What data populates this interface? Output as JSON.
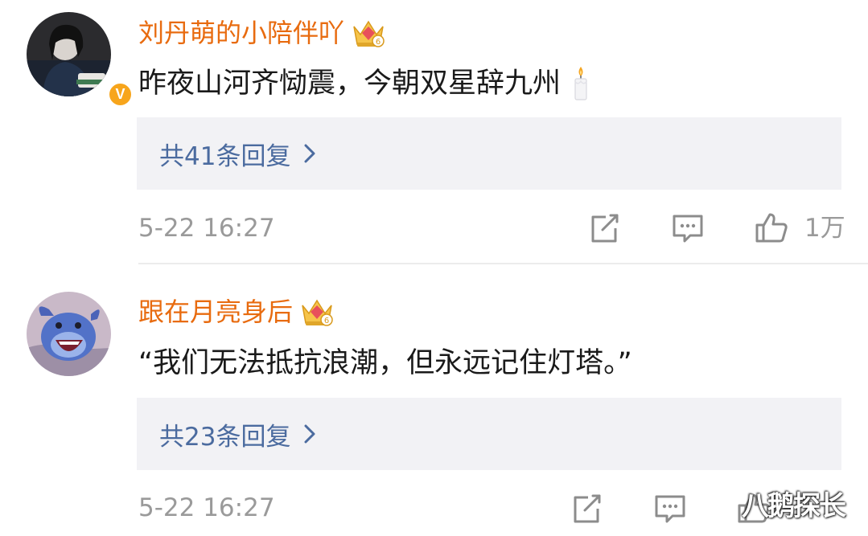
{
  "comments": [
    {
      "username": "刘丹萌的小陪伴吖",
      "text": "昨夜山河齐恸震，今朝双星辞九州",
      "verified_badge": "V",
      "reply_summary": "共41条回复",
      "timestamp": "5-22 16:27",
      "like_count": "1万"
    },
    {
      "username": "跟在月亮身后",
      "text": "“我们无法抵抗浪潮，但永远记住灯塔。”",
      "reply_summary": "共23条回复",
      "timestamp": "5-22 16:27",
      "like_count": ""
    }
  ],
  "watermark": "八鹅探长",
  "colors": {
    "username": "#e86b0f",
    "reply_link": "#4b6b9f",
    "meta_gray": "#9a9a9a",
    "reply_bg": "#f2f2f5",
    "badge": "#f7a51c"
  }
}
